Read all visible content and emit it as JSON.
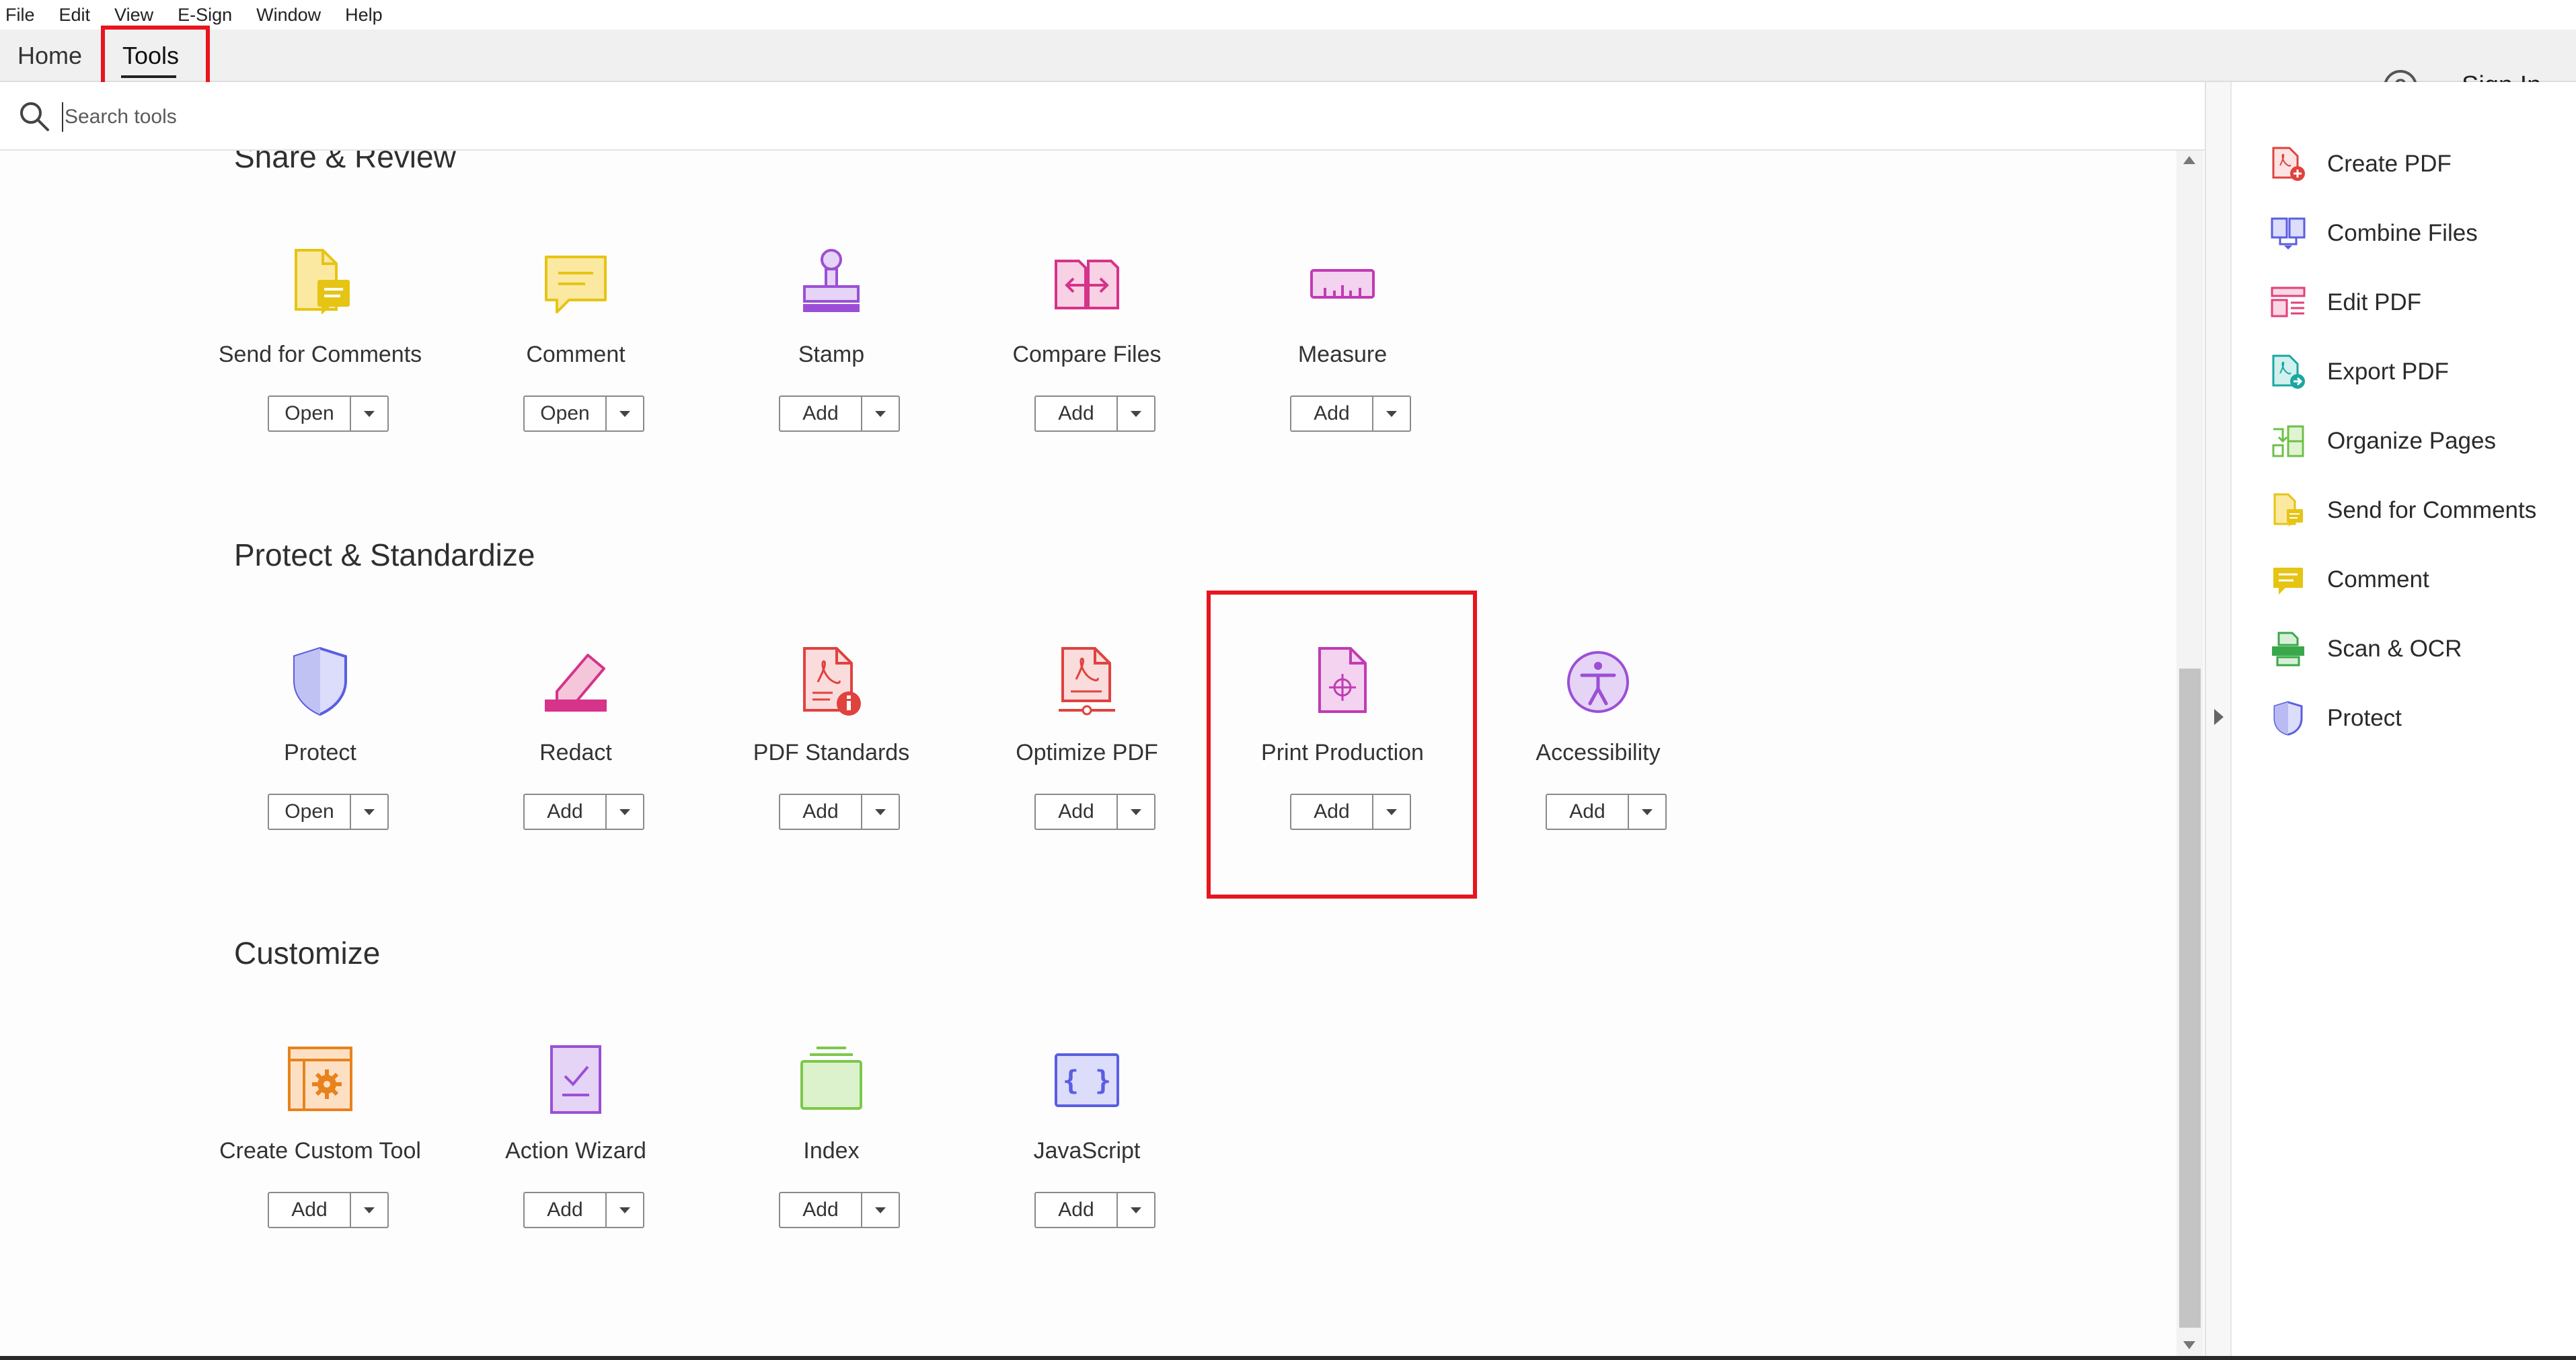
{
  "menu": [
    "File",
    "Edit",
    "View",
    "E-Sign",
    "Window",
    "Help"
  ],
  "tabs": {
    "home": "Home",
    "tools": "Tools"
  },
  "header": {
    "help_icon": "?",
    "sign_in": "Sign In"
  },
  "search": {
    "placeholder": "Search tools"
  },
  "sections": {
    "share_review": "Share & Review",
    "protect": "Protect & Standardize",
    "customize": "Customize"
  },
  "tools": {
    "send_for_comments": {
      "label": "Send for Comments",
      "btn": "Open"
    },
    "comment": {
      "label": "Comment",
      "btn": "Open"
    },
    "stamp": {
      "label": "Stamp",
      "btn": "Add"
    },
    "compare_files": {
      "label": "Compare Files",
      "btn": "Add"
    },
    "measure": {
      "label": "Measure",
      "btn": "Add"
    },
    "protect": {
      "label": "Protect",
      "btn": "Open"
    },
    "redact": {
      "label": "Redact",
      "btn": "Add"
    },
    "pdf_standards": {
      "label": "PDF Standards",
      "btn": "Add"
    },
    "optimize_pdf": {
      "label": "Optimize PDF",
      "btn": "Add"
    },
    "print_production": {
      "label": "Print Production",
      "btn": "Add"
    },
    "accessibility": {
      "label": "Accessibility",
      "btn": "Add"
    },
    "create_custom_tool": {
      "label": "Create Custom Tool",
      "btn": "Add"
    },
    "action_wizard": {
      "label": "Action Wizard",
      "btn": "Add"
    },
    "index": {
      "label": "Index",
      "btn": "Add"
    },
    "javascript": {
      "label": "JavaScript",
      "btn": "Add"
    }
  },
  "right_panel": [
    {
      "label": "Create PDF",
      "icon": "create-pdf-icon",
      "color": "#e0423e"
    },
    {
      "label": "Combine Files",
      "icon": "combine-files-icon",
      "color": "#5a5ee0"
    },
    {
      "label": "Edit PDF",
      "icon": "edit-pdf-icon",
      "color": "#e0407a"
    },
    {
      "label": "Export PDF",
      "icon": "export-pdf-icon",
      "color": "#1aa7a0"
    },
    {
      "label": "Organize Pages",
      "icon": "organize-pages-icon",
      "color": "#6cc04a"
    },
    {
      "label": "Send for Comments",
      "icon": "send-for-comments-icon",
      "color": "#e6c414"
    },
    {
      "label": "Comment",
      "icon": "comment-icon",
      "color": "#e6c414"
    },
    {
      "label": "Scan & OCR",
      "icon": "scan-ocr-icon",
      "color": "#3aa84a"
    },
    {
      "label": "Protect",
      "icon": "protect-icon",
      "color": "#5a5ee0"
    }
  ],
  "colors": {
    "highlight": "#e8141e",
    "yellow": "#e6c414",
    "purple": "#9b4fd6",
    "pink": "#d6338a",
    "red": "#e0423e",
    "blue": "#5a5ee0",
    "orange": "#e8821c",
    "green": "#7cc84a"
  }
}
